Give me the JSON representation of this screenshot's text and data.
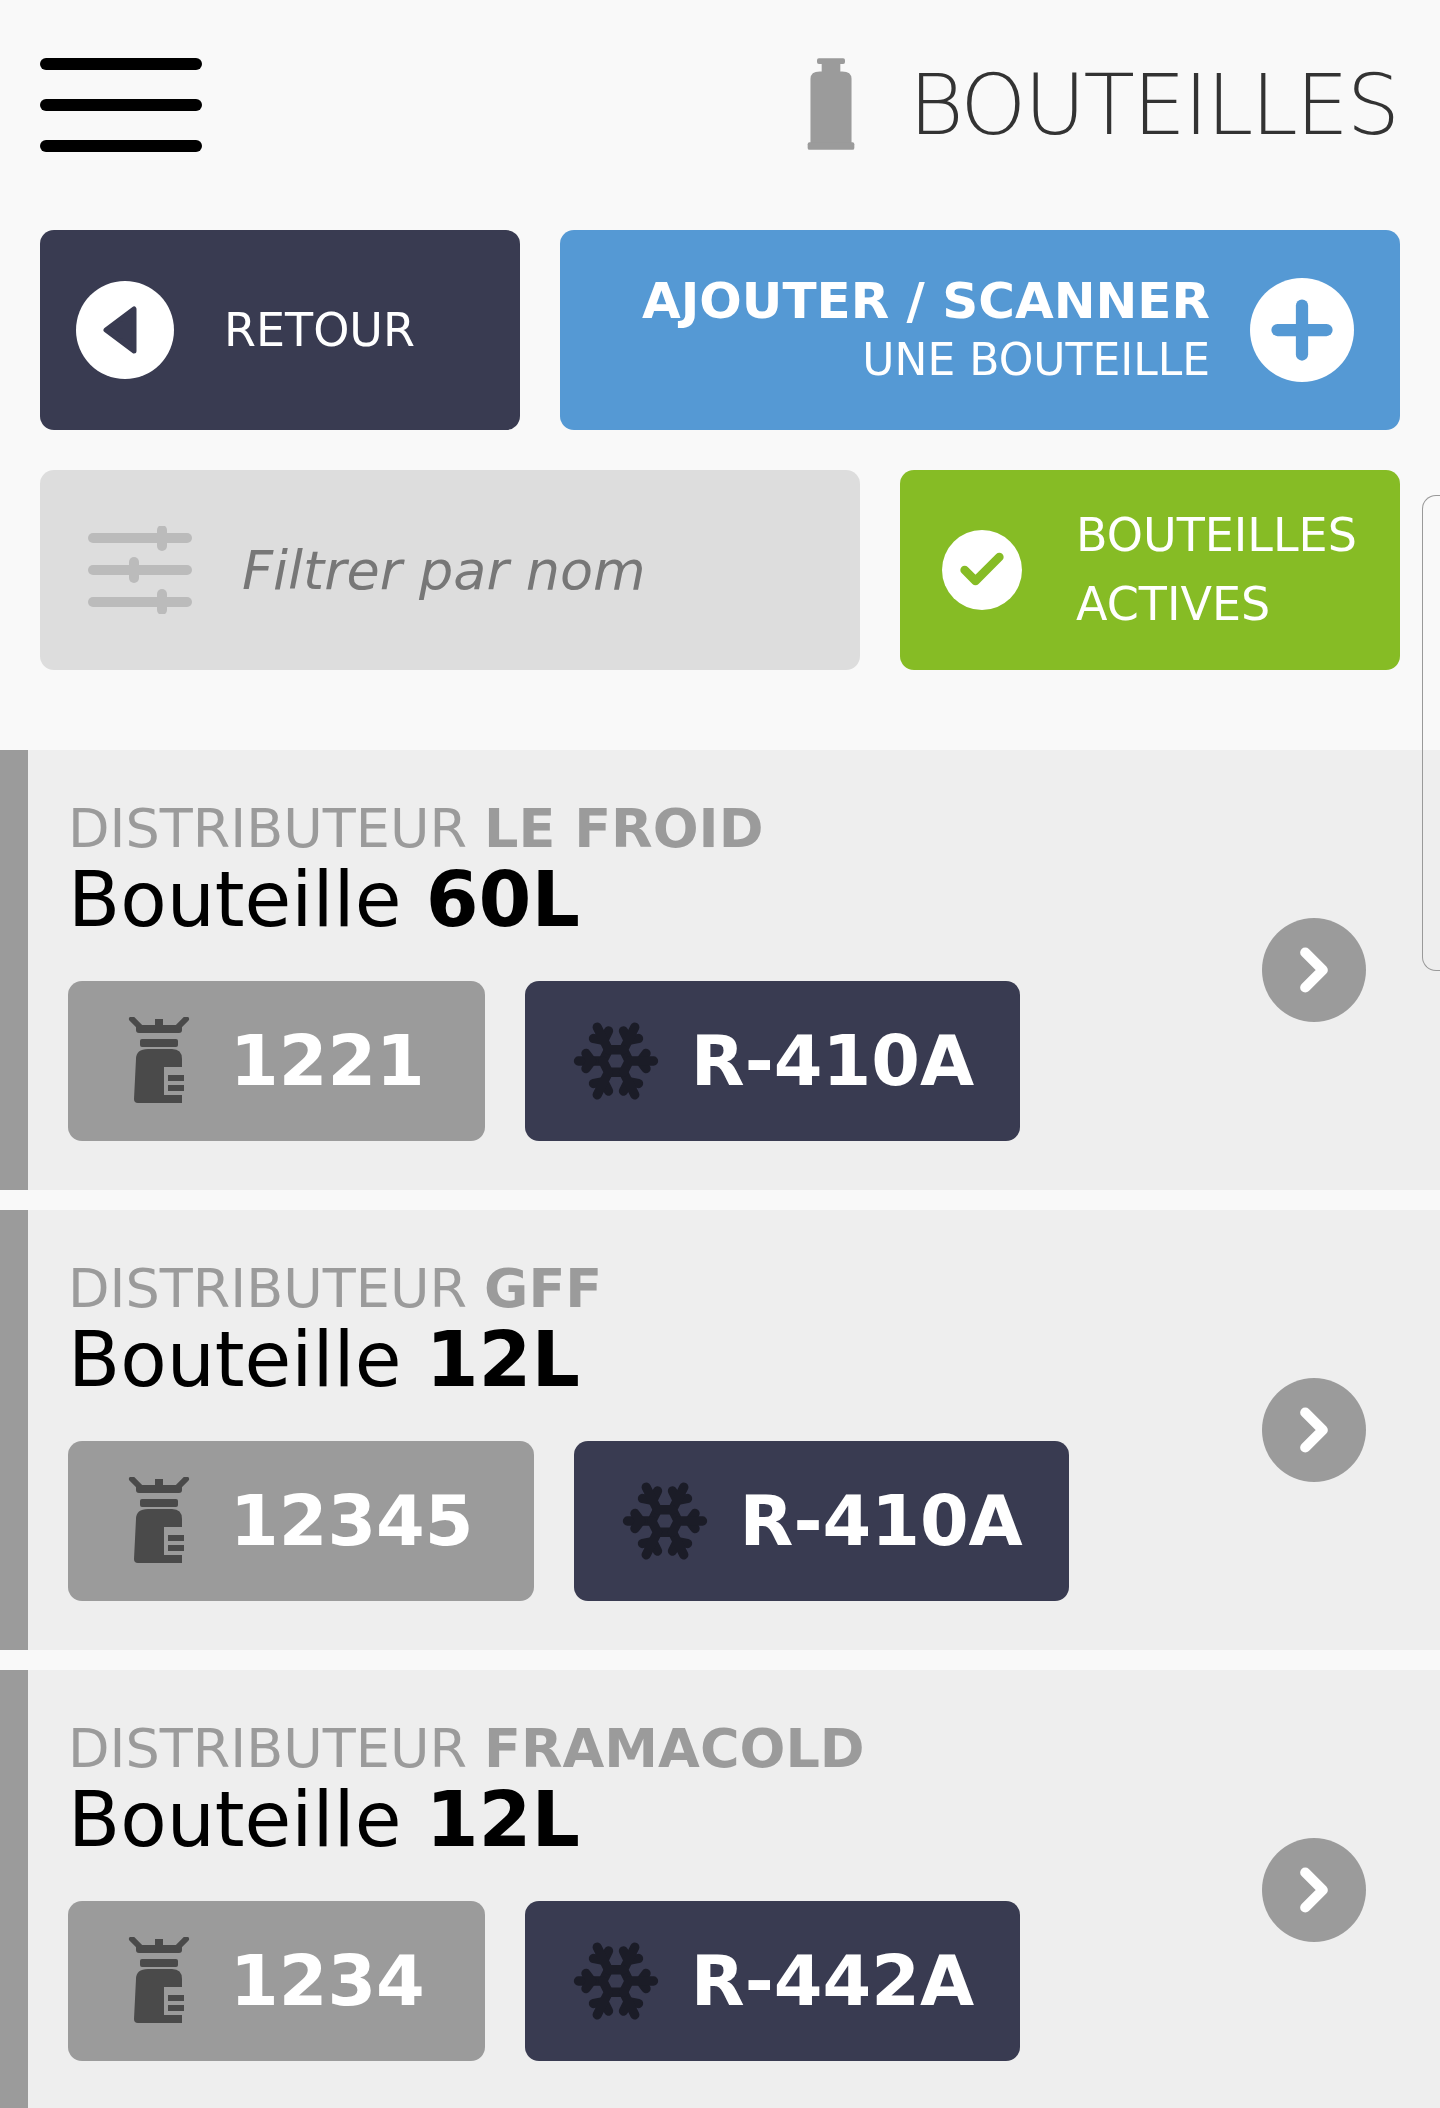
{
  "header": {
    "title": "BOUTEILLES"
  },
  "back_button": {
    "label": "RETOUR"
  },
  "add_button": {
    "line_1": "AJOUTER / SCANNER",
    "line_2": "UNE BOUTEILLE"
  },
  "filter": {
    "placeholder": "Filtrer par nom"
  },
  "active_toggle": {
    "line_1": "BOUTEILLES",
    "line_2": "ACTIVES",
    "checked": true
  },
  "bottles": [
    {
      "distributor": "DISTRIBUTEUR **LE FROID**",
      "title": "Bouteille **60L**",
      "serial": "1221",
      "gas": "R-410A"
    },
    {
      "distributor": "DISTRIBUTEUR **GFF**",
      "title": "Bouteille **12L**",
      "serial": "12345",
      "gas": "R-410A"
    },
    {
      "distributor": "DISTRIBUTEUR **FRAMACOLD**",
      "title": "Bouteille **12L**",
      "serial": "1234",
      "gas": "R-442A"
    }
  ]
}
